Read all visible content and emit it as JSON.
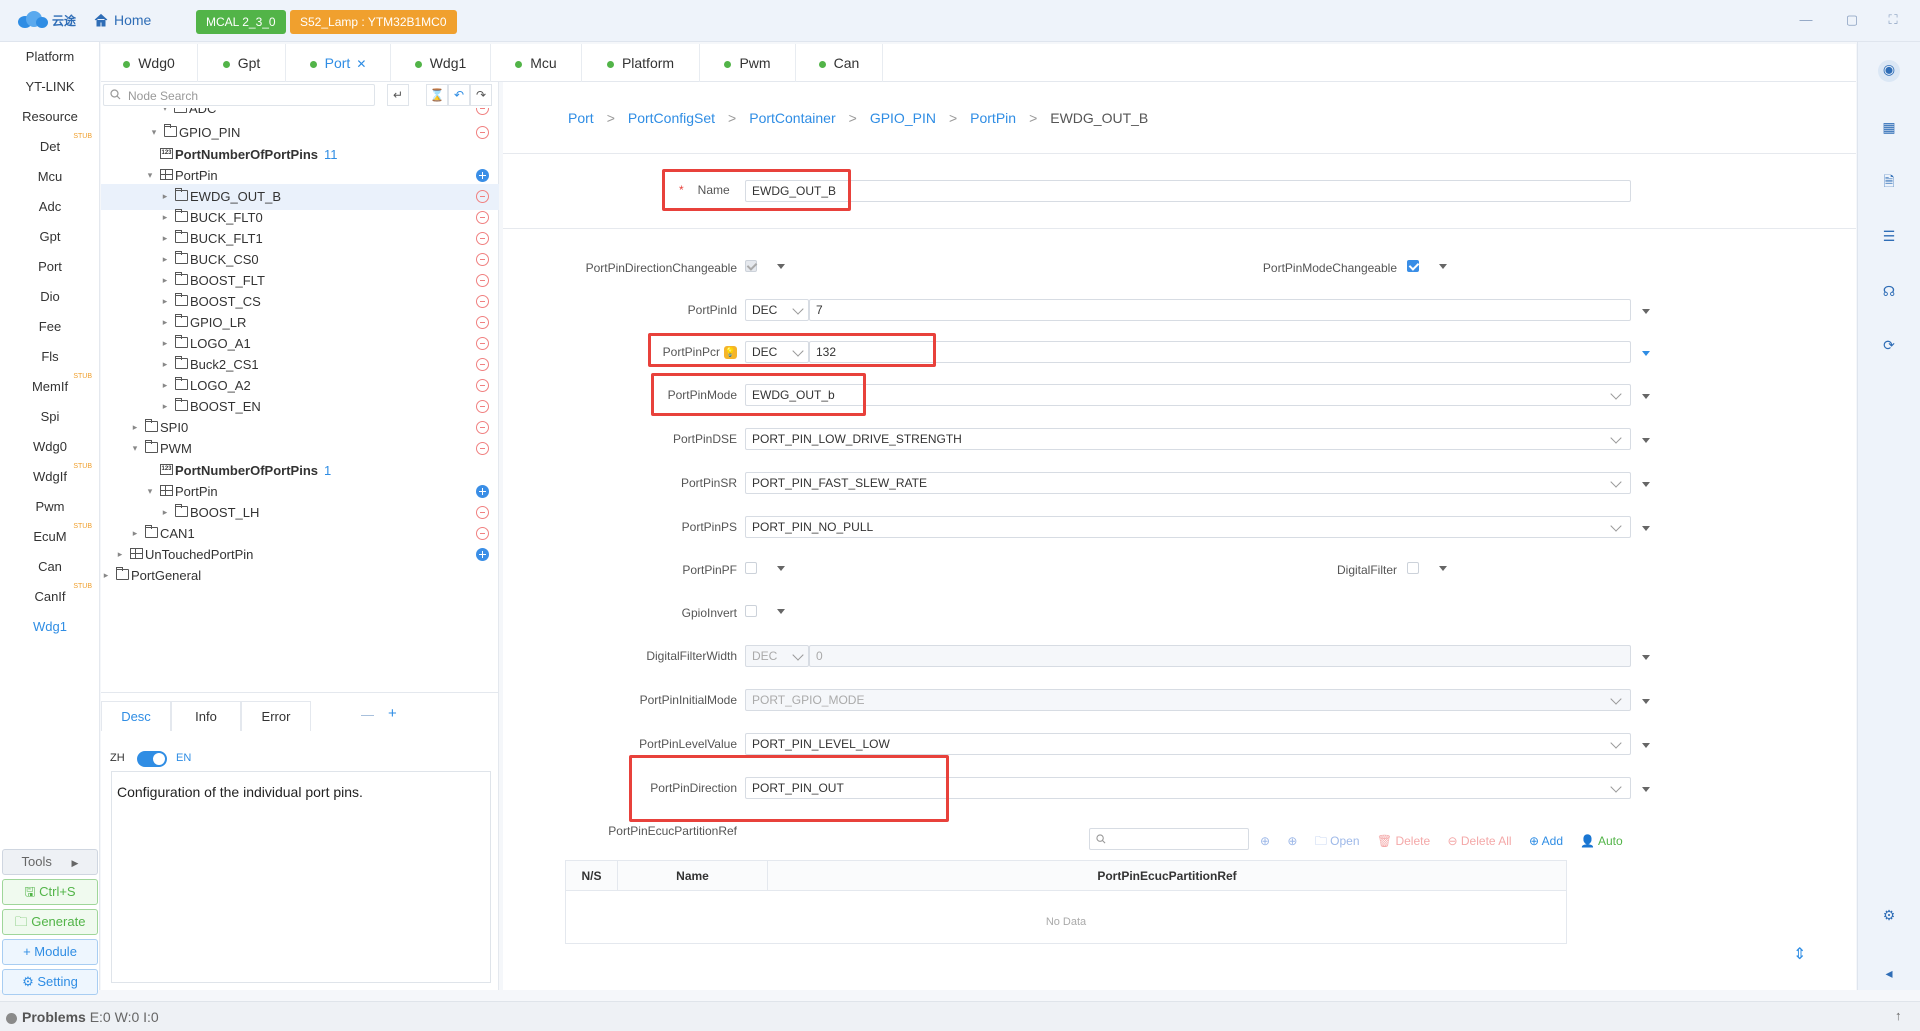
{
  "app": {
    "logo_text": "云途",
    "home_label": "Home",
    "mcal_badge": "MCAL 2_3_0",
    "project_badge": "S52_Lamp : YTM32B1MC0"
  },
  "left_nav": {
    "items": [
      {
        "label": "Platform",
        "stub": ""
      },
      {
        "label": "YT-LINK",
        "stub": ""
      },
      {
        "label": "Resource",
        "stub": ""
      },
      {
        "label": "Det",
        "stub": "STUB"
      },
      {
        "label": "Mcu",
        "stub": ""
      },
      {
        "label": "Adc",
        "stub": ""
      },
      {
        "label": "Gpt",
        "stub": ""
      },
      {
        "label": "Port",
        "stub": ""
      },
      {
        "label": "Dio",
        "stub": ""
      },
      {
        "label": "Fee",
        "stub": ""
      },
      {
        "label": "Fls",
        "stub": ""
      },
      {
        "label": "MemIf",
        "stub": "STUB"
      },
      {
        "label": "Spi",
        "stub": ""
      },
      {
        "label": "Wdg0",
        "stub": ""
      },
      {
        "label": "WdgIf",
        "stub": "STUB"
      },
      {
        "label": "Pwm",
        "stub": ""
      },
      {
        "label": "EcuM",
        "stub": "STUB"
      },
      {
        "label": "Can",
        "stub": ""
      },
      {
        "label": "CanIf",
        "stub": "STUB"
      },
      {
        "label": "Wdg1",
        "stub": ""
      }
    ],
    "active": "Wdg1",
    "tools": [
      "Tools",
      "Ctrl+S",
      "Generate",
      "Module",
      "Setting"
    ]
  },
  "tabs": [
    "Wdg0",
    "Gpt",
    "Port",
    "Wdg1",
    "Mcu",
    "Platform",
    "Pwm",
    "Can"
  ],
  "active_tab": "Port",
  "tree": {
    "search_placeholder": "Node Search",
    "rows": [
      {
        "label": "ADC",
        "count": ""
      },
      {
        "label": "GPIO_PIN",
        "count": ""
      },
      {
        "label": "PortNumberOfPortPins",
        "count": "11"
      },
      {
        "label": "PortPin",
        "count": ""
      },
      {
        "label": "EWDG_OUT_B",
        "count": ""
      },
      {
        "label": "BUCK_FLT0",
        "count": ""
      },
      {
        "label": "BUCK_FLT1",
        "count": ""
      },
      {
        "label": "BUCK_CS0",
        "count": ""
      },
      {
        "label": "BOOST_FLT",
        "count": ""
      },
      {
        "label": "BOOST_CS",
        "count": ""
      },
      {
        "label": "GPIO_LR",
        "count": ""
      },
      {
        "label": "LOGO_A1",
        "count": ""
      },
      {
        "label": "Buck2_CS1",
        "count": ""
      },
      {
        "label": "LOGO_A2",
        "count": ""
      },
      {
        "label": "BOOST_EN",
        "count": ""
      },
      {
        "label": "SPI0",
        "count": ""
      },
      {
        "label": "PWM",
        "count": ""
      },
      {
        "label": "PortNumberOfPortPins",
        "count": "1"
      },
      {
        "label": "PortPin",
        "count": ""
      },
      {
        "label": "BOOST_LH",
        "count": ""
      },
      {
        "label": "CAN1",
        "count": ""
      },
      {
        "label": "UnTouchedPortPin",
        "count": ""
      },
      {
        "label": "PortGeneral",
        "count": ""
      }
    ],
    "selected": "EWDG_OUT_B"
  },
  "desc_panel": {
    "tabs": [
      "Desc",
      "Info",
      "Error"
    ],
    "active_tab": "Desc",
    "lang_left": "ZH",
    "lang_right": "EN",
    "text": "Configuration of the individual port pins."
  },
  "breadcrumb": [
    "Port",
    "PortConfigSet",
    "PortContainer",
    "GPIO_PIN",
    "PortPin",
    "EWDG_OUT_B"
  ],
  "form": {
    "name_label": "Name",
    "name_value": "EWDG_OUT_B",
    "dir_changeable_label": "PortPinDirectionChangeable",
    "dir_changeable_checked": true,
    "mode_changeable_label": "PortPinModeChangeable",
    "mode_changeable_checked": true,
    "pinid_label": "PortPinId",
    "pinid_format": "DEC",
    "pinid_value": "7",
    "pcr_label": "PortPinPcr",
    "pcr_hint_icon": "lightbulb-icon",
    "pcr_format": "DEC",
    "pcr_value": "132",
    "mode_label": "PortPinMode",
    "mode_value": "EWDG_OUT_b",
    "dse_label": "PortPinDSE",
    "dse_value": "PORT_PIN_LOW_DRIVE_STRENGTH",
    "sr_label": "PortPinSR",
    "sr_value": "PORT_PIN_FAST_SLEW_RATE",
    "ps_label": "PortPinPS",
    "ps_value": "PORT_PIN_NO_PULL",
    "pf_label": "PortPinPF",
    "pf_checked": false,
    "digital_filter_label": "DigitalFilter",
    "digital_filter_checked": false,
    "gpio_invert_label": "GpioInvert",
    "gpio_invert_checked": false,
    "filter_width_label": "DigitalFilterWidth",
    "filter_width_format": "DEC",
    "filter_width_value": "0",
    "initial_mode_label": "PortPinInitialMode",
    "initial_mode_value": "PORT_GPIO_MODE",
    "level_label": "PortPinLevelValue",
    "level_value": "PORT_PIN_LEVEL_LOW",
    "direction_label": "PortPinDirection",
    "direction_value": "PORT_PIN_OUT",
    "ecuc_ref_label": "PortPinEcucPartitionRef"
  },
  "ref_table": {
    "toolbar": [
      "Open",
      "Delete",
      "Delete All",
      "Add",
      "Auto"
    ],
    "columns": [
      "N/S",
      "Name",
      "PortPinEcucPartitionRef"
    ],
    "empty_text": "No Data"
  },
  "status": {
    "problems_label": "Problems",
    "counts": "E:0 W:0 I:0"
  },
  "colors": {
    "accent": "#2f8de4",
    "mcal_badge": "#52b448",
    "project_badge": "#f0a02e",
    "highlight_box": "#e8413b"
  }
}
